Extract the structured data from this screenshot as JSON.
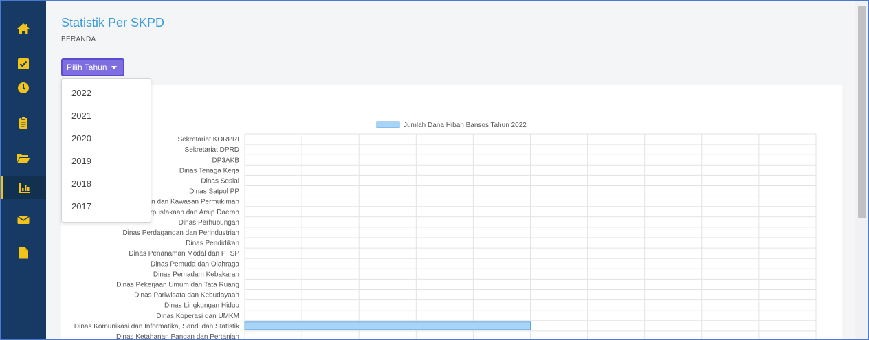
{
  "colors": {
    "sidebar_bg": "#173a64",
    "icon_yellow": "#f2c31a",
    "title_blue": "#3a9bd9",
    "button_purple": "#7f6ee0",
    "bar_fill": "#a9d4f5",
    "bar_stroke": "#5aa9e6"
  },
  "sidebar": {
    "items": [
      {
        "icon": "home-icon"
      },
      {
        "icon": "checkbox-icon"
      },
      {
        "icon": "clock-icon"
      },
      {
        "icon": "clipboard-icon"
      },
      {
        "icon": "folder-open-icon"
      },
      {
        "icon": "bar-chart-icon",
        "active": true
      },
      {
        "icon": "envelope-icon"
      },
      {
        "icon": "file-icon"
      }
    ]
  },
  "header": {
    "title": "Statistik Per SKPD",
    "breadcrumb": "BERANDA"
  },
  "year_button": {
    "label": "Pilih Tahun"
  },
  "year_dropdown": {
    "options": [
      "2022",
      "2021",
      "2020",
      "2019",
      "2018",
      "2017"
    ]
  },
  "chart_data": {
    "type": "bar",
    "orientation": "horizontal",
    "legend": "Jumlah Dana Hibah Bansos Tahun 2022",
    "legend_position": "top",
    "grid": true,
    "categories": [
      "Sekretariat KORPRI",
      "Sekretariat DPRD",
      "DP3AKB",
      "Dinas Tenaga Kerja",
      "Dinas Sosial",
      "Dinas Satpol PP",
      "Dinas Perumahan dan Kawasan Permukiman",
      "Dinas Perpustakaan dan Arsip Daerah",
      "Dinas Perhubungan",
      "Dinas Perdagangan dan Perindustrian",
      "Dinas Pendidikan",
      "Dinas Penanaman Modal dan PTSP",
      "Dinas Pemuda dan Olahraga",
      "Dinas Pemadam Kebakaran",
      "Dinas Pekerjaan Umum dan Tata Ruang",
      "Dinas Pariwisata dan Kebudayaan",
      "Dinas Lingkungan Hidup",
      "Dinas Koperasi dan UMKM",
      "Dinas Komunikasi dan Informatika, Sandi dan Statistik",
      "Dinas Ketahanan Pangan dan Pertanian"
    ],
    "values": [
      0,
      0,
      0,
      0,
      0,
      0,
      0,
      0,
      0,
      0,
      0,
      0,
      0,
      0,
      0,
      0,
      0,
      0,
      5,
      0
    ],
    "xlim": [
      0,
      10
    ]
  }
}
